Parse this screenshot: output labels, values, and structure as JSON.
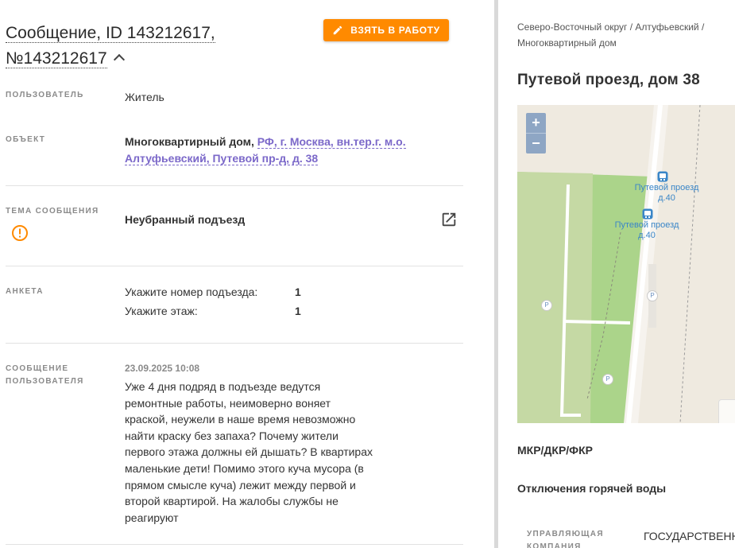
{
  "message": {
    "title": "Сообщение, ID 143212617, №143212617",
    "take_button": "ВЗЯТЬ В РАБОТУ",
    "fields": {
      "user": {
        "label": "ПОЛЬЗОВАТЕЛЬ",
        "value": "Житель"
      },
      "object": {
        "label": "ОБЪЕКТ",
        "type": "Многоквартирный дом,",
        "address": "РФ, г. Москва, вн.тер.г. м.о. Алтуфьевский, Путевой пр-д, д. 38"
      },
      "topic": {
        "label": "ТЕМА СООБЩЕНИЯ",
        "value": "Неубранный подъезд"
      },
      "survey": {
        "label": "АНКЕТА",
        "rows": [
          {
            "q": "Укажите номер подъезда:",
            "a": "1"
          },
          {
            "q": "Укажите этаж:",
            "a": "1"
          }
        ]
      },
      "user_message": {
        "label": "СООБЩЕНИЕ ПОЛЬЗОВАТЕЛЯ",
        "date": "23.09.2025 10:08",
        "text": "Уже 4 дня подряд в подъезде ведутся ремонтные работы, неимоверно воняет краской, неужели в наше время невозможно найти краску без запаха? Почему жители первого этажа должны ей дышать? В квартирах маленькие дети! Помимо этого куча мусора (в прямом смысле куча) лежит между первой и второй квартирой. На жалобы службы не реагируют"
      }
    }
  },
  "side": {
    "breadcrumb": "Северо-Восточный округ / Алтуфьевский / Многоквартирный дом",
    "address_title": "Путевой проезд, дом 38",
    "map": {
      "zoom_in": "+",
      "zoom_out": "−",
      "stop1": "Путевой проезд д.40",
      "stop2": "Путевой проезд д.40",
      "parking": "P"
    },
    "section_mkr": "МКР/ДКР/ФКР",
    "section_hot_water": "Отключения горячей воды",
    "management": {
      "label": "УПРАВЛЯЮЩАЯ КОМПАНИЯ",
      "value": "ГОСУДАРСТВЕННОЕ"
    }
  },
  "colors": {
    "accent": "#ff8a00",
    "link": "#7b68c9",
    "warning": "#ff8a00"
  }
}
